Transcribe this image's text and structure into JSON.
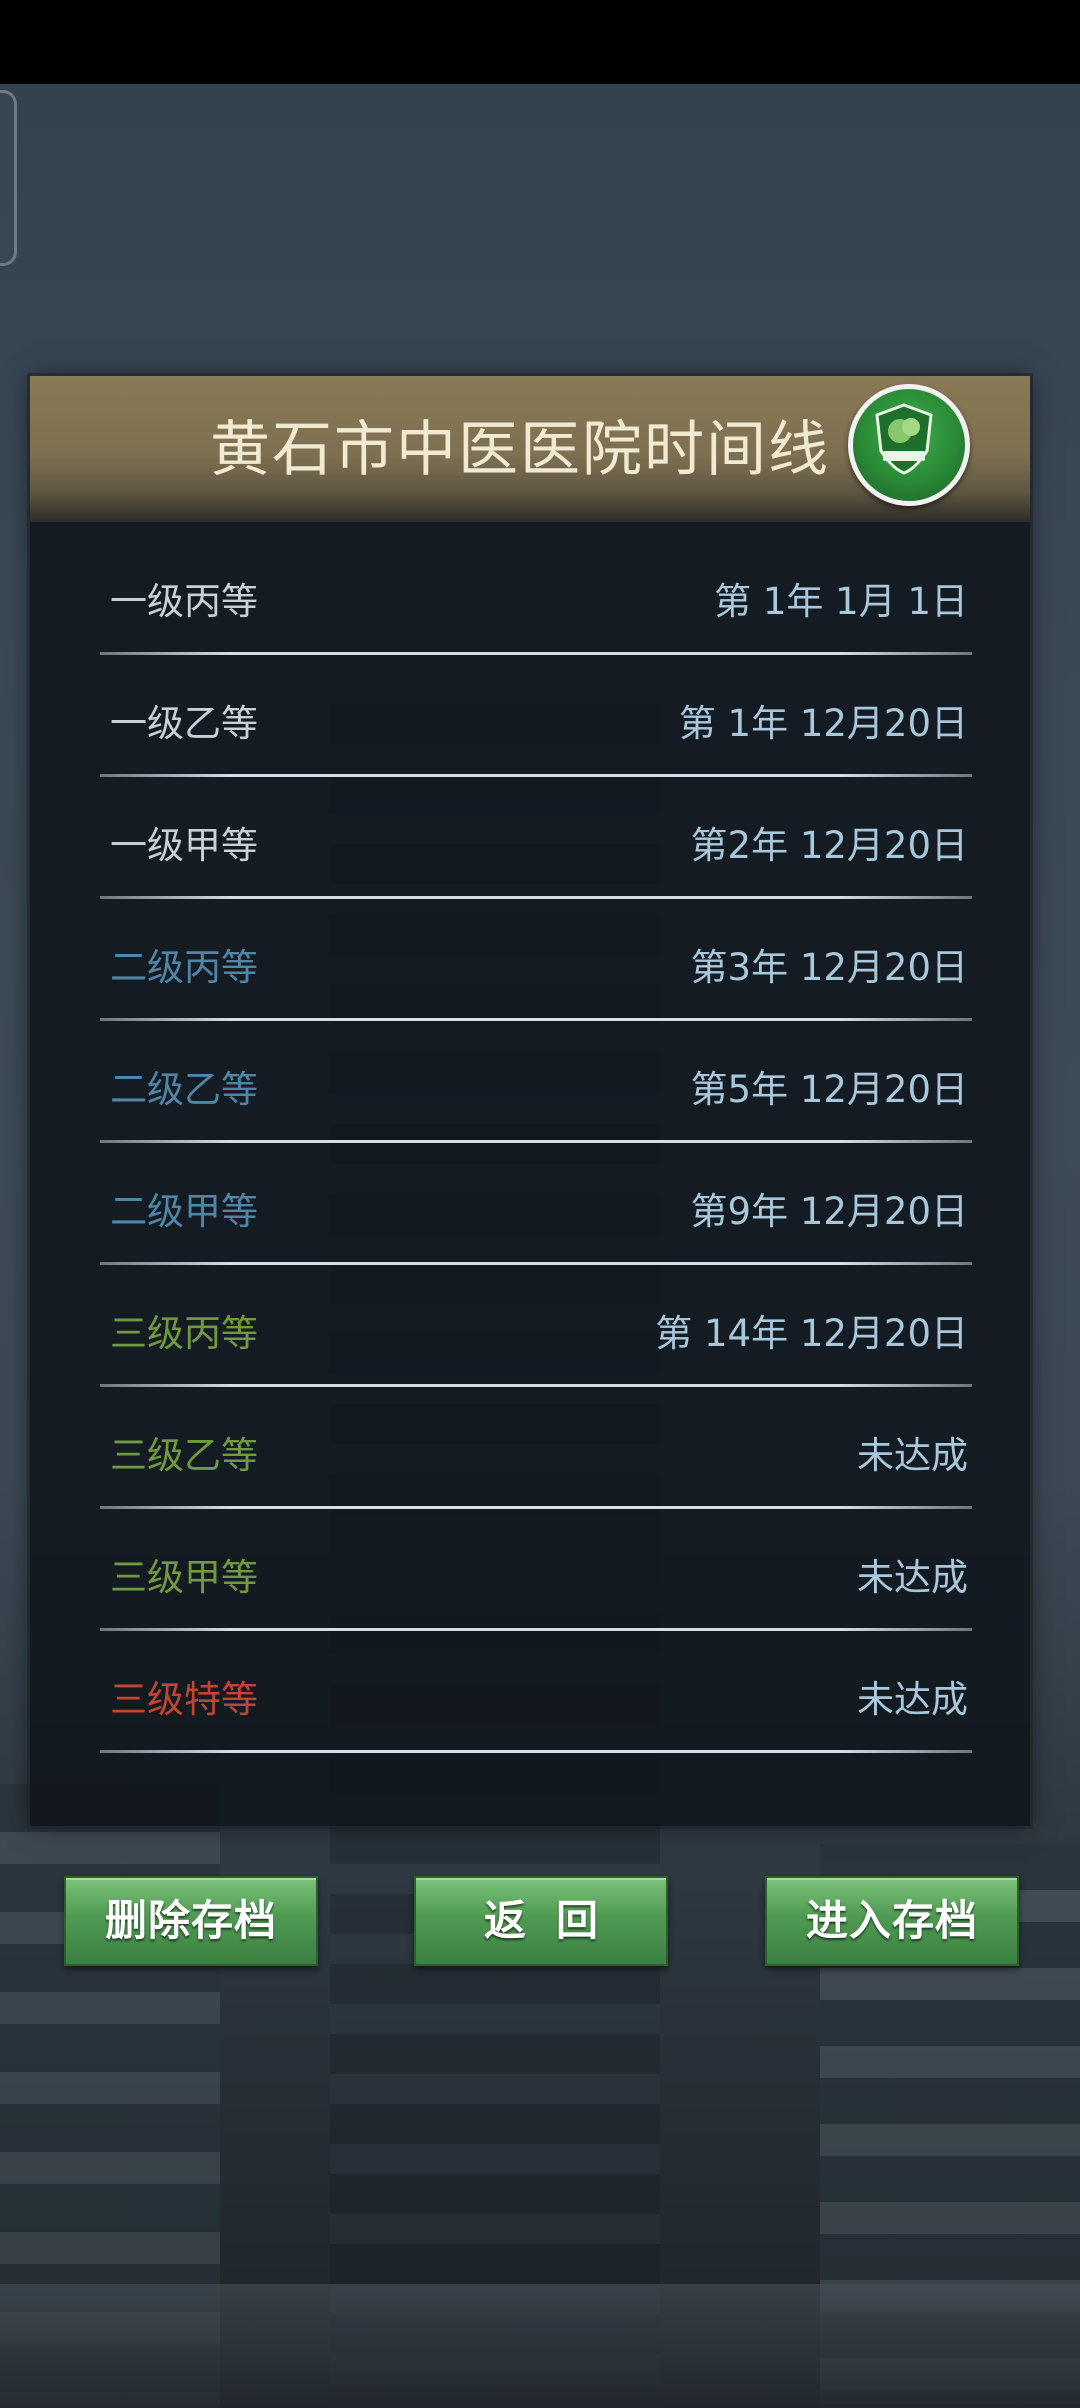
{
  "header": {
    "title": "黄石市中医医院时间线",
    "badge_icon": "hospital-emblem-icon"
  },
  "milestones": [
    {
      "label": "一级丙等",
      "value": "第 1年 1月 1日",
      "tier": "tier-1"
    },
    {
      "label": "一级乙等",
      "value": "第 1年 12月20日",
      "tier": "tier-1"
    },
    {
      "label": "一级甲等",
      "value": "第2年 12月20日",
      "tier": "tier-1"
    },
    {
      "label": "二级丙等",
      "value": "第3年 12月20日",
      "tier": "tier-2"
    },
    {
      "label": "二级乙等",
      "value": "第5年 12月20日",
      "tier": "tier-2"
    },
    {
      "label": "二级甲等",
      "value": "第9年 12月20日",
      "tier": "tier-2"
    },
    {
      "label": "三级丙等",
      "value": "第 14年 12月20日",
      "tier": "tier-3"
    },
    {
      "label": "三级乙等",
      "value": "未达成",
      "tier": "tier-3"
    },
    {
      "label": "三级甲等",
      "value": "未达成",
      "tier": "tier-3"
    },
    {
      "label": "三级特等",
      "value": "未达成",
      "tier": "tier-special"
    }
  ],
  "buttons": {
    "delete_label": "删除存档",
    "back_label": "返回",
    "enter_label": "进入存档"
  },
  "colors": {
    "tier_1": "#c9d0d4",
    "tier_2": "#4f86a6",
    "tier_3": "#6f9a3f",
    "tier_special": "#c24530",
    "value_text": "#a8c7db",
    "button_green": "#4f9a52",
    "header_gold": "#8a7a56"
  }
}
